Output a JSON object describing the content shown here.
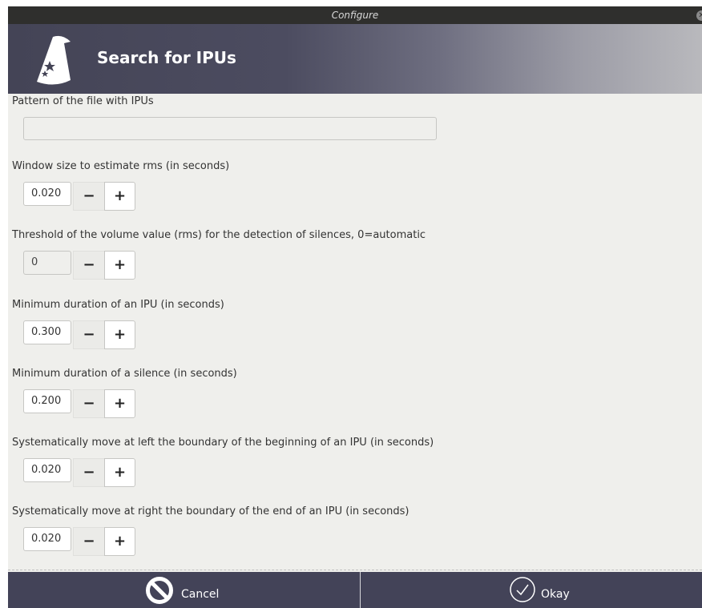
{
  "window": {
    "title": "Configure"
  },
  "banner": {
    "title": "Search for IPUs"
  },
  "fields": {
    "pattern": {
      "label": "Pattern of the file with IPUs",
      "value": "",
      "placeholder": ""
    },
    "win_length": {
      "label": "Window size to estimate rms (in seconds)",
      "value": "0.020"
    },
    "threshold": {
      "label": "Threshold of the volume value (rms) for the detection of silences, 0=automatic",
      "value": "0"
    },
    "min_ipu": {
      "label": "Minimum duration of an IPU (in seconds)",
      "value": "0.300"
    },
    "min_sil": {
      "label": "Minimum duration of a silence (in seconds)",
      "value": "0.200"
    },
    "shift_start": {
      "label": "Systematically move at left the boundary of the beginning of an IPU (in seconds)",
      "value": "0.020"
    },
    "shift_end": {
      "label": "Systematically move at right the boundary of the end of an IPU (in seconds)",
      "value": "0.020"
    }
  },
  "spin_buttons": {
    "minus": "−",
    "plus": "+"
  },
  "footer": {
    "cancel_label": "Cancel",
    "okay_label": "Okay"
  },
  "icons": {
    "close": "close-icon",
    "wizard": "wizard-hat-icon",
    "cancel": "no-entry-icon",
    "okay": "check-circle-icon"
  },
  "colors": {
    "title_bar": "#2f2f2d",
    "banner_start": "#444456",
    "banner_end": "#b9b9bd",
    "footer": "#434358",
    "content_bg": "#efefec"
  }
}
